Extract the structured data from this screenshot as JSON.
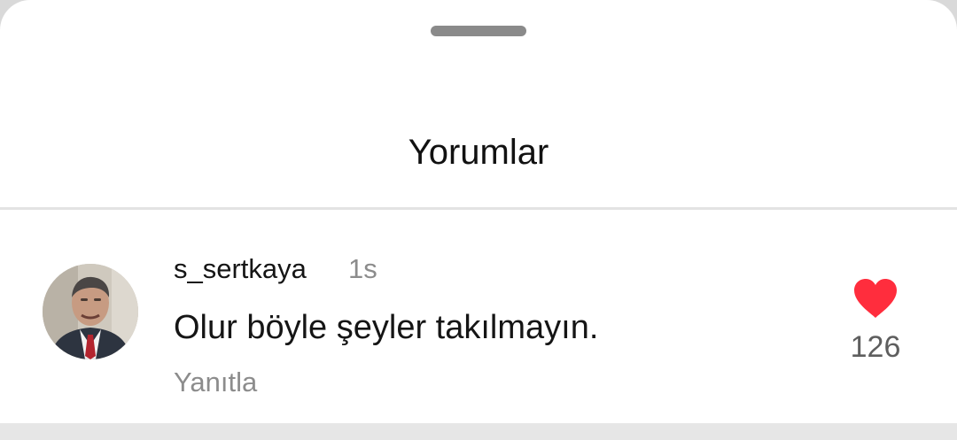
{
  "sheet": {
    "title": "Yorumlar"
  },
  "comments": [
    {
      "username": "s_sertkaya",
      "time": "1s",
      "text": "Olur böyle şeyler takılmayın.",
      "reply_label": "Yanıtla",
      "like_count": "126",
      "liked": true,
      "avatar_icon": "user-photo"
    }
  ],
  "colors": {
    "like_red": "#ff2d3d",
    "secondary_text": "#8c8c8c",
    "primary_text": "#151515"
  }
}
